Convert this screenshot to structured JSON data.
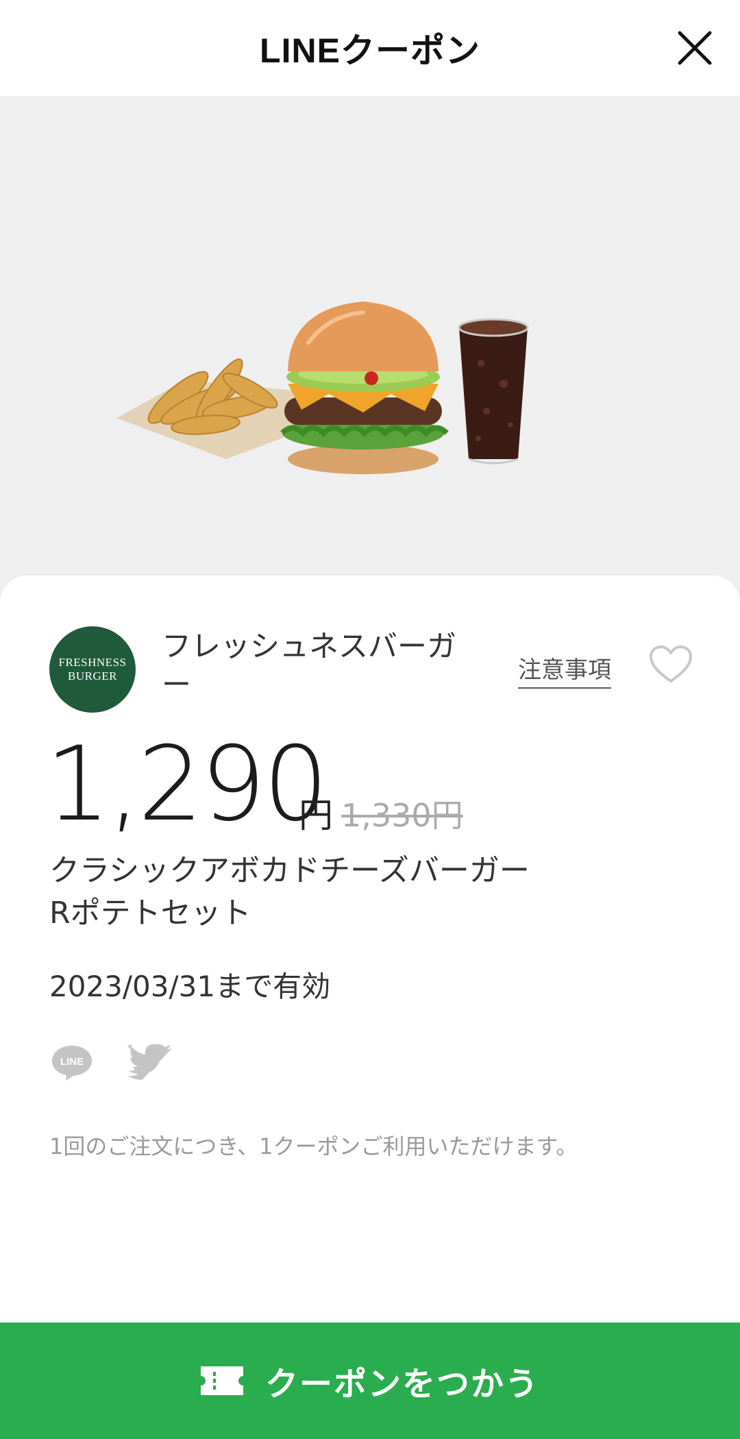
{
  "header": {
    "title": "LINEクーポン",
    "close_icon": "close-icon"
  },
  "hero": {
    "image": "burger-set-photo"
  },
  "brand": {
    "logo_line1": "FRESHNESS",
    "logo_line2": "BURGER",
    "logo_color": "#1f5a3b",
    "name": "フレッシュネスバーガー",
    "notes_label": "注意事項",
    "favorite_icon": "heart-icon"
  },
  "price": {
    "current": "1,290",
    "unit": "円",
    "original": "1,330円"
  },
  "item": {
    "name_line1": "クラシックアボカドチーズバーガー",
    "name_line2": "Rポテトセット"
  },
  "validity": "2023/03/31まで有効",
  "share": {
    "line_icon": "line-share-icon",
    "twitter_icon": "twitter-share-icon"
  },
  "note": "1回のご注文につき、1クーポンご利用いただけます。",
  "action": {
    "label": "クーポンをつかう",
    "icon": "ticket-icon",
    "color": "#2aad4e"
  }
}
